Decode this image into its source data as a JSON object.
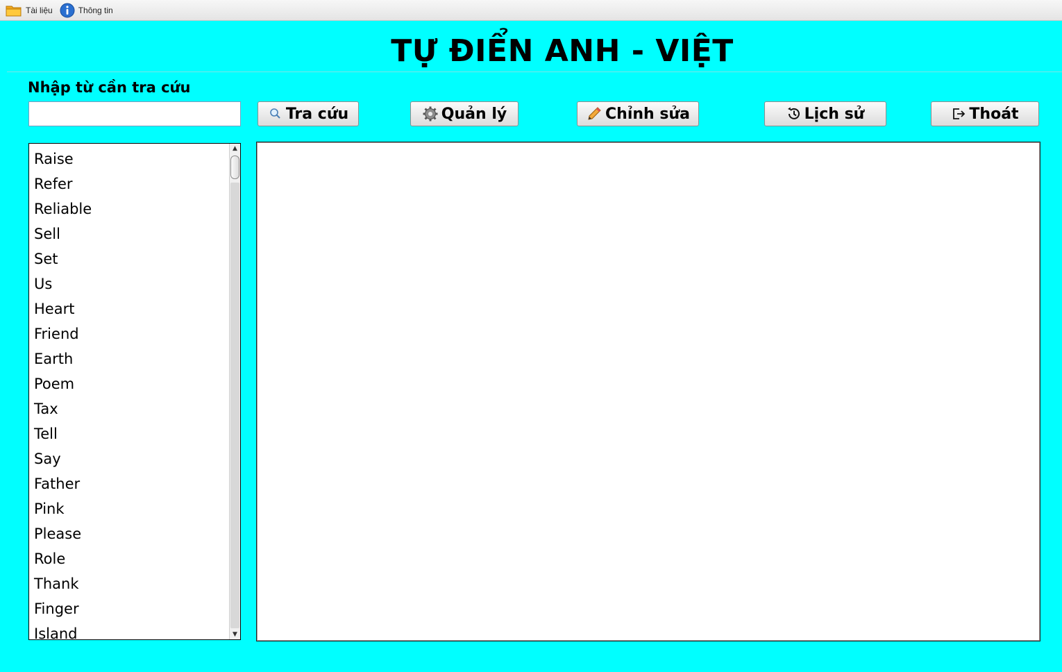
{
  "menubar": {
    "items": [
      {
        "label": "Tài liệu",
        "icon": "folder-icon"
      },
      {
        "label": "Thông tin",
        "icon": "info-icon"
      }
    ]
  },
  "header": {
    "title": "TỰ ĐIỂN ANH - VIỆT"
  },
  "search": {
    "label": "Nhập từ cần tra cứu",
    "value": "",
    "placeholder": ""
  },
  "toolbar": {
    "lookup_label": "Tra cứu",
    "manage_label": "Quản lý",
    "edit_label": "Chỉnh sửa",
    "history_label": "Lịch sử",
    "exit_label": "Thoát"
  },
  "wordlist": {
    "items": [
      "Raise",
      "Refer",
      "Reliable",
      "Sell",
      "Set",
      "Us",
      "Heart",
      "Friend",
      "Earth",
      "Poem",
      "Tax",
      "Tell",
      "Say",
      "Father",
      "Pink",
      "Please",
      "Role",
      "Thank",
      "Finger",
      "Island"
    ]
  },
  "colors": {
    "background": "#00ffff",
    "pane": "#ffffff"
  }
}
